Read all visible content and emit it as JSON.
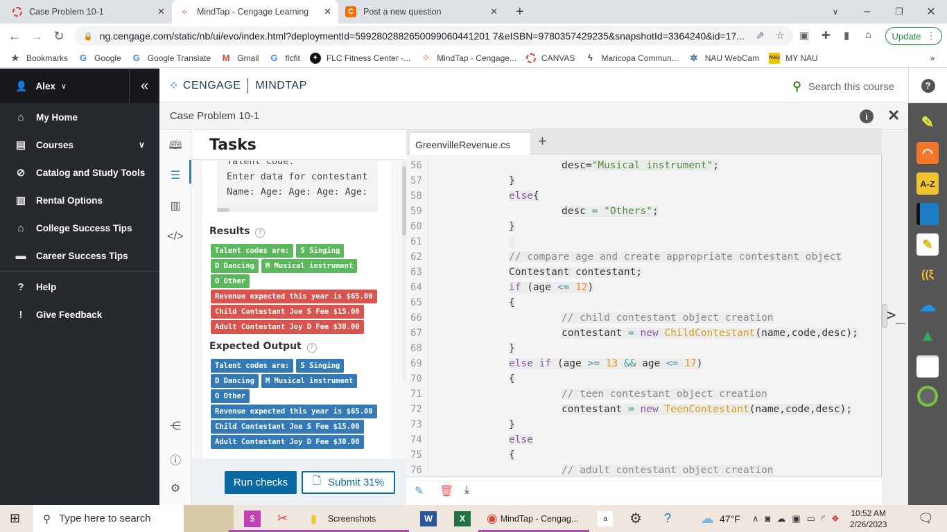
{
  "browser": {
    "tabs": [
      {
        "title": "Case Problem 10-1",
        "icon": "canvas-icon",
        "active": false
      },
      {
        "title": "MindTap - Cengage Learning",
        "icon": "mindtap-icon",
        "active": true
      },
      {
        "title": "Post a new question",
        "icon": "chegg-icon",
        "active": false
      }
    ],
    "new_tab": "+",
    "url": "ng.cengage.com/static/nb/ui/evo/index.html?deploymentId=5992802882650099060441201 7&eISBN=9780357429235&snapshotId=3364240&id=17...",
    "update_label": "Update",
    "bookmarks": [
      {
        "label": "Bookmarks",
        "icon": "star-icon"
      },
      {
        "label": "Google",
        "icon": "google-icon"
      },
      {
        "label": "Google Translate",
        "icon": "translate-icon"
      },
      {
        "label": "Gmail",
        "icon": "gmail-icon"
      },
      {
        "label": "flcfit",
        "icon": "google-icon"
      },
      {
        "label": "FLC Fitness Center -...",
        "icon": "fitness-icon"
      },
      {
        "label": "MindTap - Cengage...",
        "icon": "mindtap-icon"
      },
      {
        "label": "CANVAS",
        "icon": "canvas-icon"
      },
      {
        "label": "Maricopa Commun...",
        "icon": "maricopa-icon"
      },
      {
        "label": "NAU WebCam",
        "icon": "nau-icon"
      },
      {
        "label": "MY NAU",
        "icon": "mynau-icon"
      }
    ]
  },
  "sidebar": {
    "user": "Alex",
    "items": [
      {
        "label": "My Home",
        "icon": "home-icon"
      },
      {
        "label": "Courses",
        "icon": "book-icon"
      },
      {
        "label": "Catalog and Study Tools",
        "icon": "compass-icon"
      },
      {
        "label": "Rental Options",
        "icon": "open-book-icon"
      },
      {
        "label": "College Success Tips",
        "icon": "graduation-cap-icon"
      },
      {
        "label": "Career Success Tips",
        "icon": "briefcase-icon"
      },
      {
        "label": "Help",
        "icon": "help-icon"
      },
      {
        "label": "Give Feedback",
        "icon": "feedback-icon"
      }
    ]
  },
  "header": {
    "brand_left": "CENGAGE",
    "brand_right": "MINDTAP",
    "search_placeholder": "Search this course",
    "page_title": "Case Problem 10-1"
  },
  "tasks": {
    "title": "Tasks",
    "terminal_lines": [
      "Talent code:",
      "Enter data for contestant",
      "Name: Age: Age: Age: Age:"
    ],
    "results_label": "Results",
    "results": [
      {
        "text": "Talent codes are:",
        "status": "green"
      },
      {
        "text": "S Singing",
        "status": "green"
      },
      {
        "text": "D Dancing",
        "status": "green"
      },
      {
        "text": "M Musical instrument",
        "status": "green"
      },
      {
        "text": "O Other",
        "status": "green"
      },
      {
        "text": "Revenue expected this year is $65.00",
        "status": "red"
      },
      {
        "text": "Child Contestant Joe S Fee $15.00",
        "status": "red"
      },
      {
        "text": "Adult Contestant Joy D Fee $30.00",
        "status": "red"
      }
    ],
    "expected_label": "Expected Output",
    "expected": [
      "Talent codes are:",
      "S Singing",
      "D Dancing",
      "M Musical instrument",
      "O Other",
      "Revenue expected this year is $65.00",
      "Child Contestant Joe S Fee $15.00",
      "Adult Contestant Joy D Fee $30.00"
    ],
    "run_label": "Run checks",
    "submit_label": "Submit 31%"
  },
  "editor": {
    "filename": "GreenvilleRevenue.cs",
    "lines": [
      {
        "n": "56",
        "indent": 2,
        "tokens": [
          [
            "",
            "desc="
          ],
          [
            "str",
            "\"Musical instrument\""
          ],
          [
            "",
            ";"
          ]
        ]
      },
      {
        "n": "57",
        "indent": 1,
        "tokens": [
          [
            "",
            "}"
          ]
        ]
      },
      {
        "n": "58",
        "indent": 1,
        "tokens": [
          [
            "kw",
            "else"
          ],
          [
            "",
            "{"
          ]
        ]
      },
      {
        "n": "59",
        "indent": 2,
        "tokens": [
          [
            "",
            "desc "
          ],
          [
            "op",
            "="
          ],
          [
            "",
            " "
          ],
          [
            "str",
            "\"Others\""
          ],
          [
            "",
            ";"
          ]
        ]
      },
      {
        "n": "60",
        "indent": 1,
        "tokens": [
          [
            "",
            "}"
          ]
        ]
      },
      {
        "n": "61",
        "indent": 1,
        "tokens": [
          [
            "",
            " "
          ]
        ]
      },
      {
        "n": "62",
        "indent": 1,
        "tokens": [
          [
            "cm",
            "// compare age and create appropriate contestant object"
          ]
        ]
      },
      {
        "n": "63",
        "indent": 1,
        "tokens": [
          [
            "",
            "Contestant contestant;"
          ]
        ]
      },
      {
        "n": "64",
        "indent": 1,
        "tokens": [
          [
            "kw",
            "if"
          ],
          [
            "",
            " (age "
          ],
          [
            "op",
            "<="
          ],
          [
            "",
            " "
          ],
          [
            "num",
            "12"
          ],
          [
            "",
            ")"
          ]
        ]
      },
      {
        "n": "65",
        "indent": 1,
        "tokens": [
          [
            "",
            "{"
          ]
        ]
      },
      {
        "n": "66",
        "indent": 2,
        "tokens": [
          [
            "cm",
            "// child contestant object creation"
          ]
        ]
      },
      {
        "n": "67",
        "indent": 2,
        "tokens": [
          [
            "",
            "contestant "
          ],
          [
            "op",
            "="
          ],
          [
            "",
            " "
          ],
          [
            "kw",
            "new"
          ],
          [
            "",
            " "
          ],
          [
            "cls",
            "ChildContestant"
          ],
          [
            "",
            "(name,code,desc);"
          ]
        ]
      },
      {
        "n": "68",
        "indent": 1,
        "tokens": [
          [
            "",
            "}"
          ]
        ]
      },
      {
        "n": "69",
        "indent": 1,
        "tokens": [
          [
            "kw",
            "else if"
          ],
          [
            "",
            " (age "
          ],
          [
            "op",
            ">="
          ],
          [
            "",
            " "
          ],
          [
            "num",
            "13"
          ],
          [
            "",
            " "
          ],
          [
            "op",
            "&&"
          ],
          [
            "",
            " age "
          ],
          [
            "op",
            "<="
          ],
          [
            "",
            " "
          ],
          [
            "num",
            "17"
          ],
          [
            "",
            ")"
          ]
        ]
      },
      {
        "n": "70",
        "indent": 1,
        "tokens": [
          [
            "",
            "{"
          ]
        ]
      },
      {
        "n": "71",
        "indent": 2,
        "tokens": [
          [
            "cm",
            "// teen contestant object creation"
          ]
        ]
      },
      {
        "n": "72",
        "indent": 2,
        "tokens": [
          [
            "",
            "contestant "
          ],
          [
            "op",
            "="
          ],
          [
            "",
            " "
          ],
          [
            "kw",
            "new"
          ],
          [
            "",
            " "
          ],
          [
            "cls",
            "TeenContestant"
          ],
          [
            "",
            "(name,code,desc);"
          ]
        ]
      },
      {
        "n": "73",
        "indent": 1,
        "tokens": [
          [
            "",
            "}"
          ]
        ]
      },
      {
        "n": "74",
        "indent": 1,
        "tokens": [
          [
            "kw",
            "else"
          ]
        ]
      },
      {
        "n": "75",
        "indent": 1,
        "tokens": [
          [
            "",
            "{"
          ]
        ]
      },
      {
        "n": "76",
        "indent": 2,
        "tokens": [
          [
            "cm",
            "// adult contestant object creation"
          ]
        ]
      }
    ]
  },
  "taskbar": {
    "search_placeholder": "Type here to search",
    "screenshots_label": "Screenshots",
    "chrome_label": "MindTap - Cengag...",
    "weather": "47°F",
    "time": "10:52 AM",
    "date": "2/26/2023"
  }
}
